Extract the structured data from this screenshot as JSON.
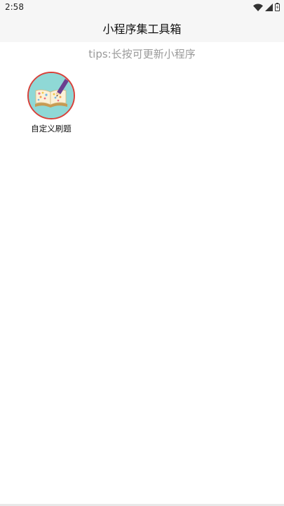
{
  "status_bar": {
    "time": "2:58",
    "icons": [
      "wifi-icon",
      "cell-signal-icon",
      "battery-icon"
    ]
  },
  "nav": {
    "title": "小程序集工具箱"
  },
  "tips": "tips:长按可更新小程序",
  "apps": [
    {
      "name": "自定义刷题",
      "icon": "book-pencil-icon"
    }
  ],
  "colors": {
    "bar_background": "#f6f6f6",
    "tips_text": "#9a9a9a",
    "icon_border": "#d9413a",
    "icon_background": "#8fd8d6"
  }
}
